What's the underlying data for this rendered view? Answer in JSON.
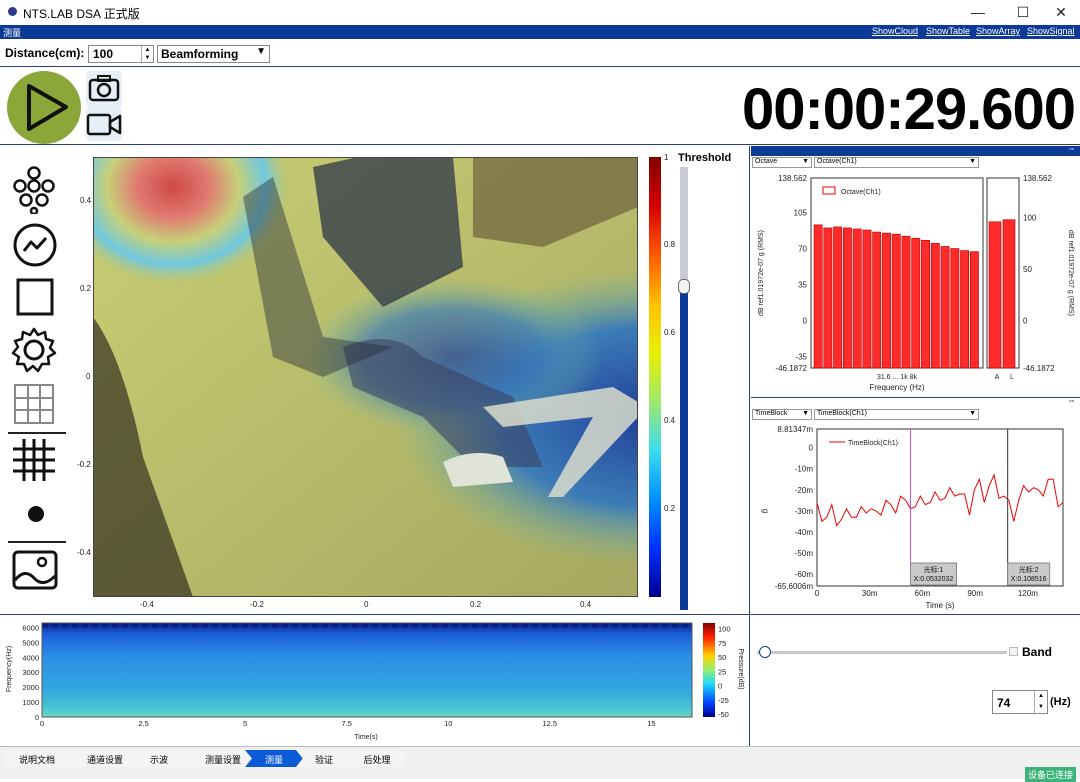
{
  "app": {
    "title": "NTS.LAB DSA 正式版",
    "tab": "测量"
  },
  "window_buttons": {
    "minimize": "—",
    "maximize": "☐",
    "close": "✕"
  },
  "links": [
    "ShowCloud",
    "ShowTable",
    "ShowArray",
    "ShowSignal"
  ],
  "toolbar": {
    "distance_label": "Distance(cm):",
    "distance_value": "100",
    "method": "Beamforming"
  },
  "timer": "00:00:29.600",
  "heatmap": {
    "x_ticks": [
      "-0.4",
      "-0.2",
      "0",
      "0.2",
      "0.4"
    ],
    "y_ticks": [
      "0.4",
      "0.2",
      "0",
      "-0.2",
      "-0.4"
    ],
    "colorbar_ticks": [
      "1",
      "0.8",
      "0.6",
      "0.4",
      "0.2"
    ],
    "threshold_label": "Threshold",
    "threshold_level": 0.74
  },
  "octave_panel": {
    "select1": "Octave",
    "select2": "Octave(Ch1)",
    "legend": "Octave(Ch1)",
    "y_ticks": [
      "138.562",
      "105",
      "70",
      "35",
      "0",
      "-35",
      "-46.1872"
    ],
    "y_ticks_right": [
      "138.562",
      "100",
      "50",
      "0",
      "-46.1872"
    ],
    "y_label": "dB ref1.01972e-07 g (RMS)",
    "x_label": "Frequency (Hz)",
    "x_tick_text": "31.6 ... 1k 8k",
    "extra_labels": [
      "A",
      "L"
    ]
  },
  "time_panel": {
    "select1": "TimeBlock",
    "select2": "TimeBlock(Ch1)",
    "legend": "TimeBlock(Ch1)",
    "y_ticks": [
      "8.81347m",
      "0",
      "-10m",
      "-20m",
      "-30m",
      "-40m",
      "-50m",
      "-60m",
      "-65.6006m"
    ],
    "y_label": "g",
    "x_ticks": [
      "0",
      "30m",
      "60m",
      "90m",
      "120m"
    ],
    "x_label": "Time (s)",
    "cursor1": {
      "name": "光标:1",
      "x": "X:0.0532032"
    },
    "cursor2": {
      "name": "光标:2",
      "x": "X:0.108516"
    }
  },
  "spectrogram": {
    "y_ticks": [
      "6000",
      "5000",
      "4000",
      "3000",
      "2000",
      "1000",
      "0"
    ],
    "y_label": "Frequency(Hz)",
    "x_ticks": [
      "0",
      "2.5",
      "5",
      "7.5",
      "10",
      "12.5",
      "15"
    ],
    "x_label": "Time(s)",
    "cb_ticks": [
      "100",
      "75",
      "50",
      "25",
      "0",
      "-25",
      "-50"
    ],
    "cb_label": "Pressure(dB)"
  },
  "band": {
    "label": "Band",
    "hz_value": "74",
    "hz_unit": "(Hz)"
  },
  "steps": [
    "说明文档",
    "通道设置",
    "示波",
    "测量设置",
    "测量",
    "验证",
    "后处理"
  ],
  "active_step": 4,
  "status": "设备已连接",
  "chart_data": [
    {
      "type": "bar",
      "title": "",
      "series": [
        {
          "name": "Octave(Ch1)",
          "values": [
            93,
            90,
            91,
            90,
            89,
            88,
            86,
            85,
            84,
            82,
            80,
            78,
            75,
            72,
            70,
            68,
            67,
            96,
            98
          ]
        }
      ],
      "ylim": [
        -46.1872,
        138.562
      ],
      "ylabel": "dB ref1.01972e-07 g (RMS)",
      "xlabel": "Frequency (Hz)"
    },
    {
      "type": "line",
      "series": [
        {
          "name": "TimeBlock(Ch1)",
          "values": [
            -0.03,
            -0.032,
            -0.035,
            -0.031,
            -0.034,
            -0.036,
            -0.033,
            -0.03,
            -0.035,
            -0.032,
            -0.028,
            -0.031,
            -0.034,
            -0.029,
            -0.027,
            -0.031,
            -0.028,
            -0.025,
            -0.029,
            -0.026,
            -0.03,
            -0.027,
            -0.024,
            -0.028,
            -0.025,
            -0.022,
            -0.026,
            -0.023,
            -0.02,
            -0.024,
            -0.026,
            -0.029,
            -0.022,
            -0.019,
            -0.023,
            -0.02,
            -0.017,
            -0.021,
            -0.025,
            -0.029,
            -0.032,
            -0.027,
            -0.022,
            -0.018,
            -0.021,
            -0.024,
            -0.02,
            -0.017,
            -0.019,
            -0.025,
            -0.028
          ]
        }
      ],
      "xlim": [
        0,
        0.14
      ],
      "ylim": [
        -0.0656006,
        0.00881347
      ],
      "xlabel": "Time (s)",
      "ylabel": "g"
    }
  ]
}
